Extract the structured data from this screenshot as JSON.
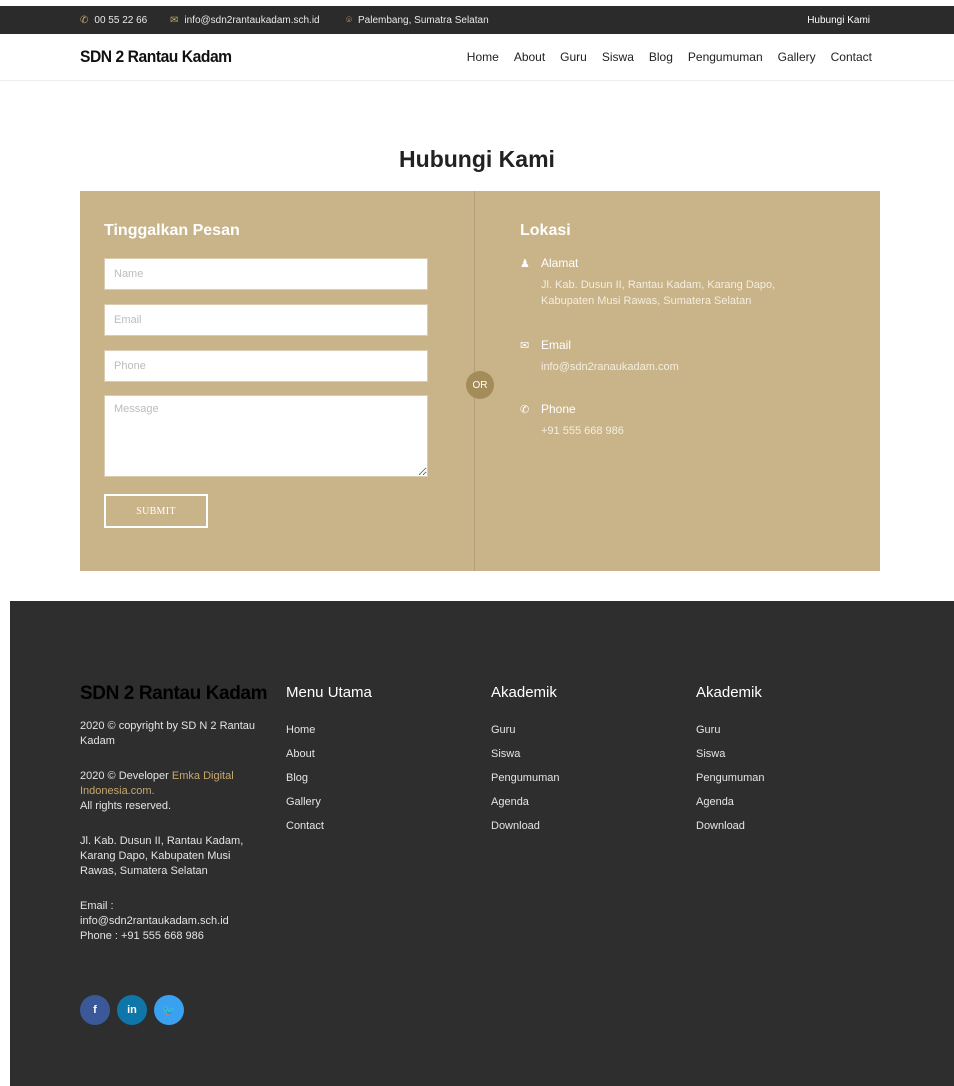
{
  "topbar": {
    "phone": "00 55 22 66",
    "email": "info@sdn2rantaukadam.sch.id",
    "location": "Palembang, Sumatra Selatan",
    "link": "Hubungi Kami"
  },
  "header": {
    "brand": "SDN 2 Rantau Kadam",
    "nav": [
      "Home",
      "About",
      "Guru",
      "Siswa",
      "Blog",
      "Pengumuman",
      "Gallery",
      "Contact"
    ]
  },
  "page": {
    "title": "Hubungi Kami"
  },
  "form": {
    "title": "Tinggalkan Pesan",
    "name_placeholder": "Name",
    "email_placeholder": "Email",
    "phone_placeholder": "Phone",
    "message_placeholder": "Message",
    "submit_label": "SUBMIT",
    "or_label": "OR"
  },
  "location": {
    "title": "Lokasi",
    "address_label": "Alamat",
    "address": "Jl. Kab. Dusun II, Rantau Kadam, Karang Dapo, Kabupaten Musi Rawas, Sumatera Selatan",
    "email_label": "Email",
    "email": "info@sdn2ranaukadam.com",
    "phone_label": "Phone",
    "phone": "+91 555 668 986"
  },
  "footer": {
    "brand": "SDN 2 Rantau Kadam",
    "copyright": "2020 © copyright by SD N 2 Rantau Kadam",
    "developer_prefix": "2020 © Developer ",
    "developer_name": "Emka Digital Indonesia.com.",
    "rights": "All rights reserved.",
    "address": "Jl. Kab. Dusun II, Rantau Kadam, Karang Dapo, Kabupaten Musi Rawas, Sumatera Selatan",
    "email_label": "Email :",
    "email": "info@sdn2rantaukadam.sch.id",
    "phone": "Phone : +91 555 668 986",
    "menu_title": "Menu Utama",
    "menu": [
      "Home",
      "About",
      "Blog",
      "Gallery",
      "Contact"
    ],
    "akademik1_title": "Akademik",
    "akademik1": [
      "Guru",
      "Siswa",
      "Pengumuman",
      "Agenda",
      "Download"
    ],
    "akademik2_title": "Akademik",
    "akademik2": [
      "Guru",
      "Siswa",
      "Pengumuman",
      "Agenda",
      "Download"
    ],
    "social": [
      {
        "icon": "facebook-icon",
        "glyph": "f",
        "color": "#3b5998"
      },
      {
        "icon": "linkedin-icon",
        "glyph": "in",
        "color": "#0e76a8"
      },
      {
        "icon": "twitter-icon",
        "glyph": "🐦",
        "color": "#3aa1f0"
      }
    ]
  },
  "colors": {
    "accent": "#c6a86c",
    "panel": "#c9b389",
    "dark": "#2e2e2e"
  }
}
